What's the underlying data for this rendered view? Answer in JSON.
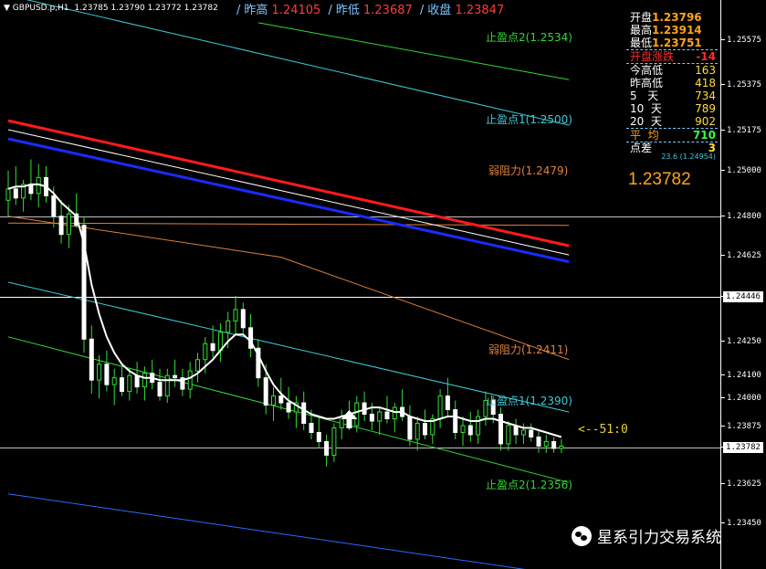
{
  "header": {
    "symbol": "GBPUSD.p,H1",
    "ohlc": "1.23785 1.23790 1.23772 1.23782"
  },
  "quick": {
    "prev_high_label": "昨高",
    "prev_high": "1.24105",
    "prev_low_label": "昨低",
    "prev_low": "1.23687",
    "prev_close_label": "收盘",
    "prev_close": "1.23847"
  },
  "panel": {
    "open_label": "开盘",
    "open": "1.23796",
    "high_label": "最高",
    "high": "1.23914",
    "low_label": "最低",
    "low": "1.23751",
    "change_label": "开盘涨跌",
    "change": "-14",
    "today_range_label": "今高低",
    "today_range": "163",
    "yest_range_label": "昨高低",
    "yest_range": "418",
    "d5_label": "5   天",
    "d5": "734",
    "d10_label": "10  天",
    "d10": "789",
    "d20_label": "20  天",
    "d20": "902",
    "avg_label": "平  均",
    "avg": "710",
    "spread_label": "点差",
    "spread": "3",
    "spread_sub": "23.6  (1.24954)",
    "price": "1.23782"
  },
  "levels": {
    "tp2_top": "止盈点2(1.2534)",
    "tp1_top": "止盈点1(1.2500)",
    "res_top": "弱阻力(1.2479)",
    "res_mid": "弱阻力(1.2411)",
    "tp1_bot": "止盈点1(1.2390)",
    "tp2_bot": "止盈点2(1.2356)"
  },
  "countdown": "<--51:0",
  "watermark": "星系引力交易系统",
  "colors": {
    "bg": "#000000",
    "candle": "#ffffff",
    "wick": "#33e033",
    "ma_red": "#ff1a1a",
    "ma_blue": "#1a2bff",
    "ma_white": "#ffffff",
    "band_orange": "#e0813a",
    "band_cyan": "#3ec9d6",
    "band_green": "#35d435",
    "band_blue": "#2a6bff"
  },
  "chart_data": {
    "type": "candlestick",
    "symbol": "GBPUSD.p",
    "timeframe": "H1",
    "ylim": [
      1.2325,
      1.2575
    ],
    "ticks": [
      "1.25575",
      "1.25375",
      "1.25175",
      "1.25000",
      "1.24800",
      "1.24625",
      "1.24446",
      "1.24250",
      "1.24100",
      "1.24000",
      "1.23875",
      "1.23782",
      "1.23625",
      "1.23450",
      "1.23250"
    ],
    "current_price": 1.23782,
    "horizontal_lines": [
      1.248,
      1.24446,
      1.23782
    ],
    "bars": [
      {
        "o": 1.2487,
        "h": 1.25,
        "l": 1.248,
        "c": 1.2492
      },
      {
        "o": 1.2492,
        "h": 1.2502,
        "l": 1.2485,
        "c": 1.2488
      },
      {
        "o": 1.2488,
        "h": 1.2496,
        "l": 1.2482,
        "c": 1.2494
      },
      {
        "o": 1.2494,
        "h": 1.2505,
        "l": 1.2487,
        "c": 1.249
      },
      {
        "o": 1.249,
        "h": 1.2503,
        "l": 1.2484,
        "c": 1.2497
      },
      {
        "o": 1.2497,
        "h": 1.2502,
        "l": 1.2486,
        "c": 1.2489
      },
      {
        "o": 1.2489,
        "h": 1.2493,
        "l": 1.2475,
        "c": 1.248
      },
      {
        "o": 1.248,
        "h": 1.2487,
        "l": 1.2468,
        "c": 1.2472
      },
      {
        "o": 1.2472,
        "h": 1.2485,
        "l": 1.2466,
        "c": 1.2481
      },
      {
        "o": 1.2481,
        "h": 1.249,
        "l": 1.2475,
        "c": 1.2476
      },
      {
        "o": 1.2476,
        "h": 1.248,
        "l": 1.242,
        "c": 1.2426
      },
      {
        "o": 1.2426,
        "h": 1.2432,
        "l": 1.2402,
        "c": 1.2408
      },
      {
        "o": 1.2408,
        "h": 1.2419,
        "l": 1.24,
        "c": 1.2415
      },
      {
        "o": 1.2415,
        "h": 1.2421,
        "l": 1.2403,
        "c": 1.2406
      },
      {
        "o": 1.2406,
        "h": 1.2413,
        "l": 1.2397,
        "c": 1.2409
      },
      {
        "o": 1.2409,
        "h": 1.2414,
        "l": 1.2401,
        "c": 1.2403
      },
      {
        "o": 1.2403,
        "h": 1.2413,
        "l": 1.2399,
        "c": 1.241
      },
      {
        "o": 1.241,
        "h": 1.2416,
        "l": 1.2402,
        "c": 1.2405
      },
      {
        "o": 1.2405,
        "h": 1.2414,
        "l": 1.2399,
        "c": 1.2411
      },
      {
        "o": 1.2411,
        "h": 1.2417,
        "l": 1.2404,
        "c": 1.2407
      },
      {
        "o": 1.2407,
        "h": 1.2413,
        "l": 1.2399,
        "c": 1.2401
      },
      {
        "o": 1.2401,
        "h": 1.2413,
        "l": 1.2398,
        "c": 1.241
      },
      {
        "o": 1.241,
        "h": 1.2417,
        "l": 1.2405,
        "c": 1.2409
      },
      {
        "o": 1.2409,
        "h": 1.2413,
        "l": 1.2401,
        "c": 1.2404
      },
      {
        "o": 1.2404,
        "h": 1.2416,
        "l": 1.24,
        "c": 1.2412
      },
      {
        "o": 1.2412,
        "h": 1.242,
        "l": 1.2407,
        "c": 1.2417
      },
      {
        "o": 1.2417,
        "h": 1.2427,
        "l": 1.2411,
        "c": 1.2424
      },
      {
        "o": 1.2424,
        "h": 1.2432,
        "l": 1.2418,
        "c": 1.2421
      },
      {
        "o": 1.2421,
        "h": 1.2433,
        "l": 1.2416,
        "c": 1.2429
      },
      {
        "o": 1.2429,
        "h": 1.2438,
        "l": 1.2422,
        "c": 1.2434
      },
      {
        "o": 1.2434,
        "h": 1.2445,
        "l": 1.2428,
        "c": 1.2439
      },
      {
        "o": 1.2439,
        "h": 1.2442,
        "l": 1.2428,
        "c": 1.2431
      },
      {
        "o": 1.2431,
        "h": 1.2437,
        "l": 1.2418,
        "c": 1.2422
      },
      {
        "o": 1.2422,
        "h": 1.2426,
        "l": 1.2405,
        "c": 1.2409
      },
      {
        "o": 1.2409,
        "h": 1.2415,
        "l": 1.2393,
        "c": 1.2397
      },
      {
        "o": 1.2397,
        "h": 1.2405,
        "l": 1.239,
        "c": 1.2401
      },
      {
        "o": 1.2401,
        "h": 1.2409,
        "l": 1.2395,
        "c": 1.2398
      },
      {
        "o": 1.2398,
        "h": 1.2405,
        "l": 1.2391,
        "c": 1.2394
      },
      {
        "o": 1.2394,
        "h": 1.2401,
        "l": 1.2387,
        "c": 1.2398
      },
      {
        "o": 1.2398,
        "h": 1.2403,
        "l": 1.2386,
        "c": 1.2389
      },
      {
        "o": 1.2389,
        "h": 1.2395,
        "l": 1.2382,
        "c": 1.2385
      },
      {
        "o": 1.2385,
        "h": 1.2392,
        "l": 1.2378,
        "c": 1.2381
      },
      {
        "o": 1.2381,
        "h": 1.2384,
        "l": 1.237,
        "c": 1.2375
      },
      {
        "o": 1.2375,
        "h": 1.2389,
        "l": 1.2372,
        "c": 1.2387
      },
      {
        "o": 1.2387,
        "h": 1.2395,
        "l": 1.2382,
        "c": 1.2392
      },
      {
        "o": 1.2392,
        "h": 1.2399,
        "l": 1.2386,
        "c": 1.2388
      },
      {
        "o": 1.2388,
        "h": 1.2401,
        "l": 1.2385,
        "c": 1.2398
      },
      {
        "o": 1.2398,
        "h": 1.2403,
        "l": 1.239,
        "c": 1.2393
      },
      {
        "o": 1.2393,
        "h": 1.2398,
        "l": 1.2386,
        "c": 1.239
      },
      {
        "o": 1.239,
        "h": 1.2396,
        "l": 1.2384,
        "c": 1.2394
      },
      {
        "o": 1.2394,
        "h": 1.2401,
        "l": 1.2389,
        "c": 1.2391
      },
      {
        "o": 1.2391,
        "h": 1.2398,
        "l": 1.2385,
        "c": 1.2396
      },
      {
        "o": 1.2396,
        "h": 1.2404,
        "l": 1.239,
        "c": 1.2392
      },
      {
        "o": 1.2392,
        "h": 1.2397,
        "l": 1.2379,
        "c": 1.2382
      },
      {
        "o": 1.2382,
        "h": 1.2392,
        "l": 1.2377,
        "c": 1.2389
      },
      {
        "o": 1.2389,
        "h": 1.2395,
        "l": 1.2382,
        "c": 1.2384
      },
      {
        "o": 1.2384,
        "h": 1.2393,
        "l": 1.238,
        "c": 1.2391
      },
      {
        "o": 1.2391,
        "h": 1.2404,
        "l": 1.2387,
        "c": 1.2401
      },
      {
        "o": 1.2401,
        "h": 1.2409,
        "l": 1.2392,
        "c": 1.2395
      },
      {
        "o": 1.2395,
        "h": 1.2399,
        "l": 1.2382,
        "c": 1.2385
      },
      {
        "o": 1.2385,
        "h": 1.2392,
        "l": 1.2379,
        "c": 1.2388
      },
      {
        "o": 1.2388,
        "h": 1.2394,
        "l": 1.2381,
        "c": 1.2384
      },
      {
        "o": 1.2384,
        "h": 1.2395,
        "l": 1.238,
        "c": 1.2392
      },
      {
        "o": 1.2392,
        "h": 1.2403,
        "l": 1.2388,
        "c": 1.2399
      },
      {
        "o": 1.2399,
        "h": 1.2401,
        "l": 1.2389,
        "c": 1.2393
      },
      {
        "o": 1.2393,
        "h": 1.2396,
        "l": 1.2377,
        "c": 1.238
      },
      {
        "o": 1.238,
        "h": 1.239,
        "l": 1.2377,
        "c": 1.2388
      },
      {
        "o": 1.2388,
        "h": 1.2391,
        "l": 1.238,
        "c": 1.2384
      },
      {
        "o": 1.2384,
        "h": 1.2389,
        "l": 1.238,
        "c": 1.2386
      },
      {
        "o": 1.2386,
        "h": 1.2389,
        "l": 1.2381,
        "c": 1.2383
      },
      {
        "o": 1.2383,
        "h": 1.2386,
        "l": 1.2376,
        "c": 1.2379
      },
      {
        "o": 1.2379,
        "h": 1.2384,
        "l": 1.2376,
        "c": 1.2381
      },
      {
        "o": 1.2381,
        "h": 1.2383,
        "l": 1.2376,
        "c": 1.2378
      },
      {
        "o": 1.2378,
        "h": 1.2382,
        "l": 1.2376,
        "c": 1.2379
      }
    ],
    "ma_white": [
      1.2492,
      1.2493,
      1.2493,
      1.2494,
      1.2494,
      1.2493,
      1.249,
      1.2486,
      1.2483,
      1.248,
      1.2468,
      1.245,
      1.2437,
      1.2427,
      1.242,
      1.2415,
      1.2412,
      1.241,
      1.2409,
      1.2409,
      1.2408,
      1.2408,
      1.2408,
      1.2408,
      1.2409,
      1.2411,
      1.2414,
      1.2417,
      1.2421,
      1.2425,
      1.2428,
      1.2428,
      1.2425,
      1.2419,
      1.2412,
      1.2406,
      1.2402,
      1.2399,
      1.2397,
      1.2395,
      1.2393,
      1.2392,
      1.2391,
      1.2391,
      1.2392,
      1.2393,
      1.2394,
      1.2395,
      1.2396,
      1.2396,
      1.2395,
      1.2394,
      1.2394,
      1.2392,
      1.2391,
      1.239,
      1.239,
      1.2391,
      1.2392,
      1.2392,
      1.2391,
      1.239,
      1.239,
      1.2391,
      1.2391,
      1.239,
      1.2389,
      1.2388,
      1.2387,
      1.2387,
      1.2386,
      1.2385,
      1.2384,
      1.2383
    ],
    "ma_red": [
      [
        0,
        1.2522
      ],
      [
        74,
        1.2467
      ]
    ],
    "ma_blue": [
      [
        0,
        1.2514
      ],
      [
        74,
        1.246
      ]
    ],
    "bands": [
      {
        "color": "band_cyan",
        "pts": [
          [
            0,
            1.2577
          ],
          [
            74,
            1.252
          ]
        ]
      },
      {
        "color": "band_green",
        "pts": [
          [
            33,
            1.2565
          ],
          [
            74,
            1.254
          ]
        ]
      },
      {
        "color": "band_orange",
        "pts": [
          [
            0,
            1.2477
          ],
          [
            74,
            1.2476
          ]
        ]
      },
      {
        "color": "band_cyan",
        "pts": [
          [
            0,
            1.2451
          ],
          [
            74,
            1.2394
          ]
        ]
      },
      {
        "color": "band_green",
        "pts": [
          [
            0,
            1.2427
          ],
          [
            74,
            1.2363
          ]
        ]
      },
      {
        "color": "band_orange",
        "pts": [
          [
            0,
            1.248
          ],
          [
            36,
            1.2462
          ],
          [
            74,
            1.2417
          ]
        ]
      },
      {
        "color": "band_blue",
        "pts": [
          [
            0,
            1.2358
          ],
          [
            74,
            1.2322
          ]
        ]
      }
    ],
    "arrow_bar": 45
  }
}
